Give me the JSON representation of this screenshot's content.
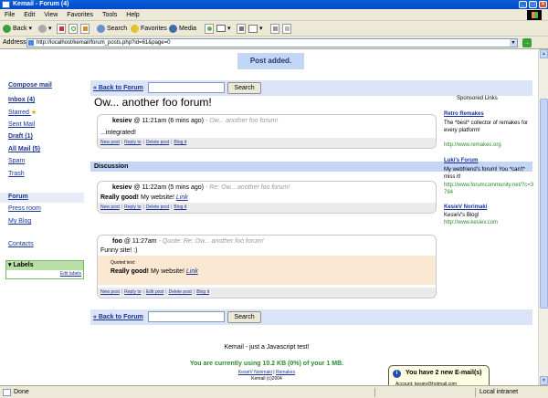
{
  "window": {
    "title": "Kemail - Forum (4)"
  },
  "menu": [
    "File",
    "Edit",
    "View",
    "Favorites",
    "Tools",
    "Help"
  ],
  "toolbar": {
    "back": "Back",
    "search": "Search",
    "favorites": "Favorites",
    "media": "Media"
  },
  "address": {
    "label": "Address",
    "url": "http://localhost/kemail/forum_posts.php?id=61&page=0",
    "go": "→"
  },
  "notice": "Post added.",
  "nav": {
    "compose": "Compose mail",
    "inbox": "Inbox (4)",
    "starred": "Starred",
    "sent": "Sent Mail",
    "draft": "Draft (1)",
    "allmail": "All Mail (5)",
    "spam": "Spam",
    "trash": "Trash",
    "forum": "Forum",
    "press": "Press room",
    "blog": "My Blog",
    "contacts": "Contacts",
    "labels": "Labels",
    "edit_labels": "Edit labels"
  },
  "forum": {
    "back": "« Back to Forum",
    "search_button": "Search",
    "title": "Ow... another foo forum!",
    "discussion": "Discussion"
  },
  "posts": [
    {
      "author": "kesiev",
      "time": "@ 11:21am (6 mins ago)",
      "subject": "- Ow... another foo forum!",
      "body": "...integrated!",
      "actions": [
        "New post",
        "Reply to",
        "Delete post",
        "Blog it"
      ]
    },
    {
      "author": "kesiev",
      "time": "@ 11:22am (5 mins ago)",
      "subject": "- Re: Ow... another foo forum!",
      "body_bold": "Really good!",
      "body_text": " My website! ",
      "body_link": "Link",
      "actions": [
        "New post",
        "Reply to",
        "Delete post",
        "Blog it"
      ]
    },
    {
      "author": "foo",
      "time": "@ 11:27am",
      "subject": "- Quote: Re: Ow... another foo forum!",
      "body": "Funny site! :)",
      "quote_header": "Quoted text:",
      "quote_bold": "Really good!",
      "quote_text": " My website! ",
      "quote_link": "Link",
      "actions": [
        "New post",
        "Reply to",
        "Edit post",
        "Delete post",
        "Blog it"
      ]
    }
  ],
  "ads": {
    "header": "Sponsored Links",
    "items": [
      {
        "title": "Retro Remakes",
        "text": "The *best* collector of remakes for every platform!",
        "url": "http://www.remakes.org"
      },
      {
        "title": "Luki's Forum",
        "text": "My webfriend's forum! You *can't* miss it!",
        "url": "http://www.forumcommunity.net/?c=3784"
      },
      {
        "title": "KesieV Norimaki",
        "text": "KesieV's Blog!",
        "url": "http://www.kesiev.com"
      }
    ]
  },
  "footer": {
    "tagline": "Kemail - just a Javascript test!",
    "usage": "You are currently using 10.2 KB (0%) of your 1 MB.",
    "link1": "KesieV Norimaki",
    "sep": " | ",
    "link2": "Remakes",
    "copy": "Kemail (c)2004"
  },
  "balloon": {
    "title": "You have 2 new E-mail(s)",
    "account": "Account: kesiev@hotmail.com"
  },
  "status": {
    "left": "Done",
    "zone": "Local intranet"
  }
}
